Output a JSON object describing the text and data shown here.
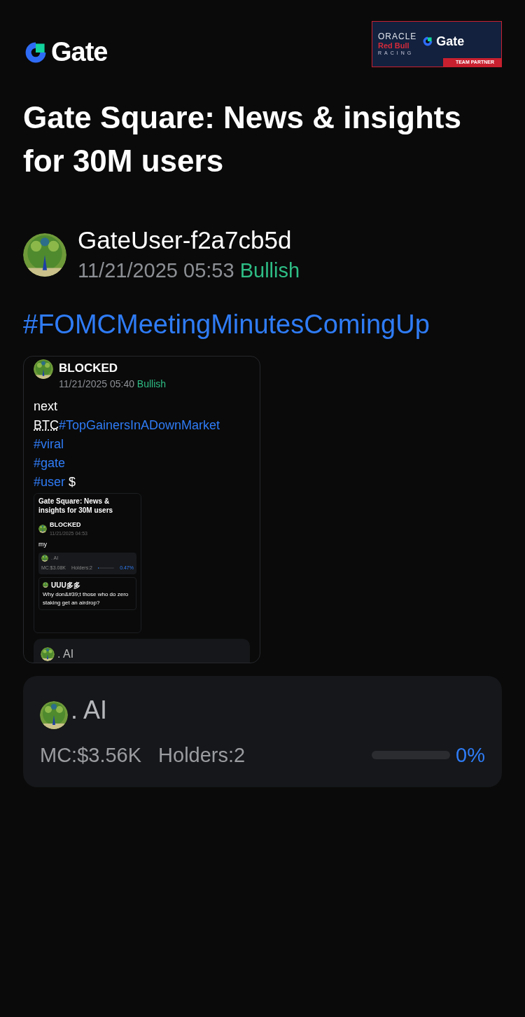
{
  "header": {
    "logo_text": "Gate",
    "partner_badge": {
      "line_1": "ORACLE",
      "line_2": "Red Bull",
      "line_3": "RACING",
      "brand": "Gate",
      "caption": "TEAM PARTNER"
    }
  },
  "title": "Gate Square: News & insights for 30M users",
  "post": {
    "author": "GateUser-f2a7cb5d",
    "time": "11/21/2025 05:53",
    "sentiment": "Bullish",
    "hashtag": "#FOMCMeetingMinutesComingUp",
    "quoted": {
      "author": "BLOCKED",
      "time": "11/21/2025 05:40",
      "sentiment": "Bullish",
      "lines": [
        [
          {
            "kind": "text",
            "text": "next"
          }
        ],
        [
          {
            "kind": "abbr",
            "text": "BTC"
          },
          {
            "kind": "tag",
            "text": "#TopGainersInADownMarket"
          }
        ],
        [
          {
            "kind": "tag",
            "text": "#viral"
          }
        ],
        [
          {
            "kind": "tag",
            "text": "#gate"
          }
        ],
        [
          {
            "kind": "tag",
            "text": "#user"
          },
          {
            "kind": "text",
            "text": " $"
          }
        ]
      ],
      "screenshot": {
        "title": "Gate Square: News & insights for 30M users",
        "author": "BLOCKED",
        "time": "11/21/2025 04:53",
        "body": "my",
        "token": {
          "name": ". AI",
          "mc": "MC:$3.08K",
          "holders": "Holders:2",
          "level": 0.0047,
          "percent": "0.47%"
        },
        "comment": {
          "author": "UUU多多",
          "text": "Why don&#39;t those who do zero staking get an airdrop?"
        }
      },
      "token": {
        "name": ". AI"
      }
    },
    "token": {
      "name": ". AI",
      "mc": "MC:$3.56K",
      "holders": "Holders:2",
      "level": 0,
      "percent": "0%"
    }
  }
}
